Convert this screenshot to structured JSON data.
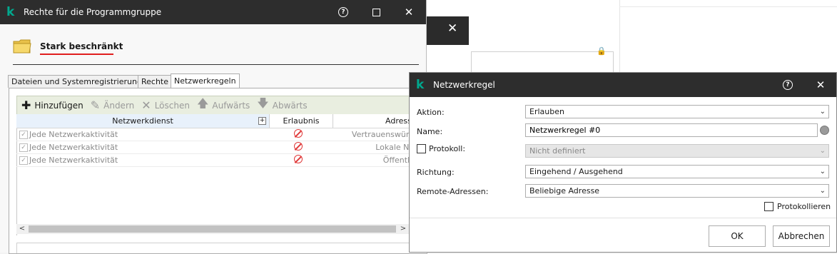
{
  "left_window": {
    "title": "Rechte für die Programmgruppe",
    "group_name": "Stark beschränkt",
    "tabs": [
      {
        "label": "Dateien und Systemregistrierung"
      },
      {
        "label": "Rechte"
      },
      {
        "label": "Netzwerkregeln"
      }
    ],
    "toolbar": {
      "add": "Hinzufügen",
      "edit": "Ändern",
      "delete": "Löschen",
      "up": "Aufwärts",
      "down": "Abwärts"
    },
    "columns": {
      "service": "Netzwerkdienst",
      "permission": "Erlaubnis",
      "address": "Adresse"
    },
    "rows": [
      {
        "service": "Jede Netzwerkaktivität",
        "permission": "deny-icon",
        "address": "Vertrauenswürdige"
      },
      {
        "service": "Jede Netzwerkaktivität",
        "permission": "deny-icon",
        "address": "Lokale Netze"
      },
      {
        "service": "Jede Netzwerkaktivität",
        "permission": "deny-icon",
        "address": "Öffentliche"
      }
    ]
  },
  "rule_dialog": {
    "title": "Netzwerkregel",
    "action_label": "Aktion:",
    "action_value": "Erlauben",
    "name_label": "Name:",
    "name_value": "Netzwerkregel #0",
    "protocol_label": "Protokoll:",
    "protocol_value": "Nicht definiert",
    "direction_label": "Richtung:",
    "direction_value": "Eingehend / Ausgehend",
    "remote_label": "Remote-Adressen:",
    "remote_value": "Beliebige Adresse",
    "log_label": "Protokollieren",
    "ok": "OK",
    "cancel": "Abbrechen"
  },
  "colors": {
    "titlebar": "#2d2d2d",
    "brand_k": "#00a88e",
    "deny": "#e03a3a",
    "underline": "#e01e1e"
  }
}
